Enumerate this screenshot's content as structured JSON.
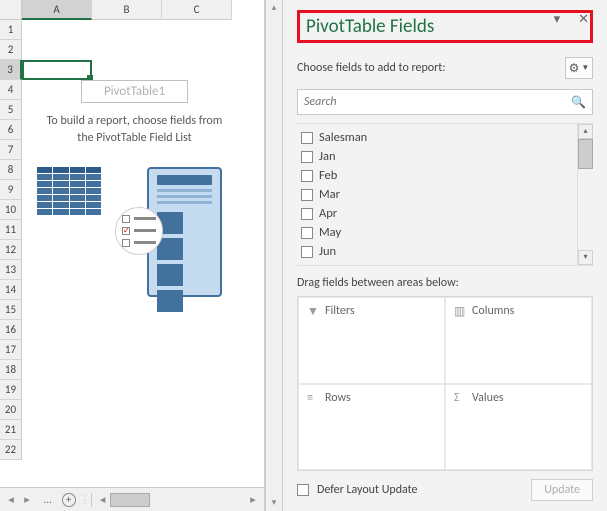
{
  "grid": {
    "columns": [
      "A",
      "B",
      "C"
    ],
    "rows": [
      "1",
      "2",
      "3",
      "4",
      "5",
      "6",
      "7",
      "8",
      "9",
      "10",
      "11",
      "12",
      "13",
      "14",
      "15",
      "16",
      "17",
      "18",
      "19",
      "20",
      "21",
      "22"
    ],
    "selected_cell": "A3"
  },
  "pivot_placeholder": {
    "title": "PivotTable1",
    "text": "To build a report, choose fields from the PivotTable Field List"
  },
  "pane": {
    "title": "PivotTable Fields",
    "choose_label": "Choose fields to add to report:",
    "search_placeholder": "Search",
    "fields": [
      "Salesman",
      "Jan",
      "Feb",
      "Mar",
      "Apr",
      "May",
      "Jun"
    ],
    "drag_label": "Drag fields between areas below:",
    "areas": {
      "filters": "Filters",
      "columns": "Columns",
      "rows": "Rows",
      "values": "Values"
    },
    "defer_label": "Defer Layout Update",
    "update_label": "Update"
  }
}
